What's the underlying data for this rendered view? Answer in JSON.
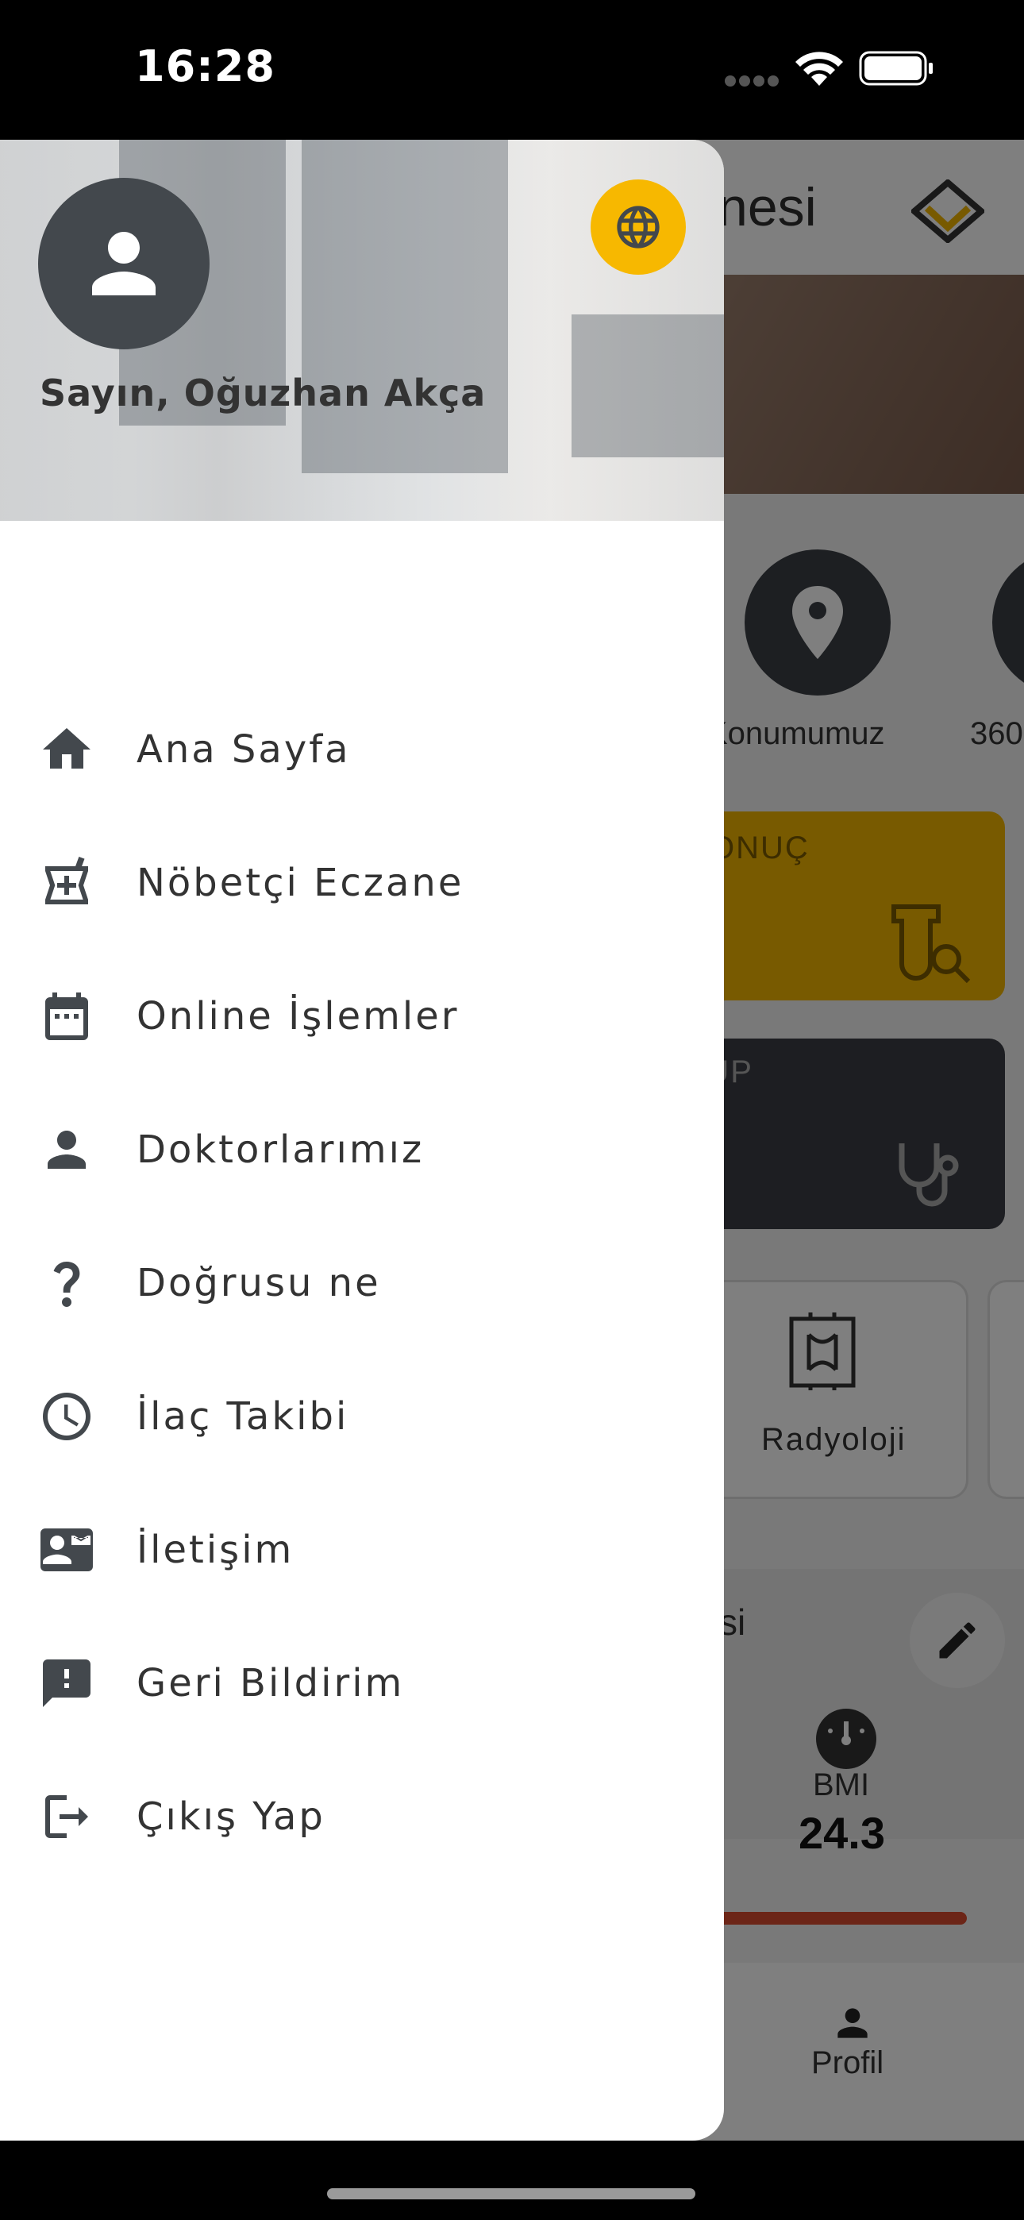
{
  "status_bar": {
    "time": "16:28"
  },
  "background_app": {
    "title_fragment": "nesi",
    "quick_links": [
      "Konumumuz",
      "360"
    ],
    "card_yellow_fragment": "ONUÇ",
    "card_dark_fragment": "-UP",
    "tile_label": "Radyoloji",
    "health_fragment": "si",
    "bmi_label": "BMI",
    "bmi_value": "24.3",
    "tab_profile": "Profil"
  },
  "drawer": {
    "greeting": "Sayın, Oğuzhan Akça",
    "language_icon": "globe-icon",
    "items": [
      {
        "label": "Ana Sayfa",
        "icon": "home-icon"
      },
      {
        "label": "Nöbetçi Eczane",
        "icon": "pharmacy-icon"
      },
      {
        "label": "Online İşlemler",
        "icon": "calendar-icon"
      },
      {
        "label": "Doktorlarımız",
        "icon": "person-icon"
      },
      {
        "label": "Doğrusu ne",
        "icon": "question-icon"
      },
      {
        "label": "İlaç Takibi",
        "icon": "clock-icon"
      },
      {
        "label": "İletişim",
        "icon": "contact-card-icon"
      },
      {
        "label": "Geri Bildirim",
        "icon": "feedback-icon"
      },
      {
        "label": "Çıkış Yap",
        "icon": "logout-icon"
      }
    ]
  },
  "colors": {
    "accent": "#F7B800",
    "icon": "#43484D",
    "text": "#333333"
  }
}
